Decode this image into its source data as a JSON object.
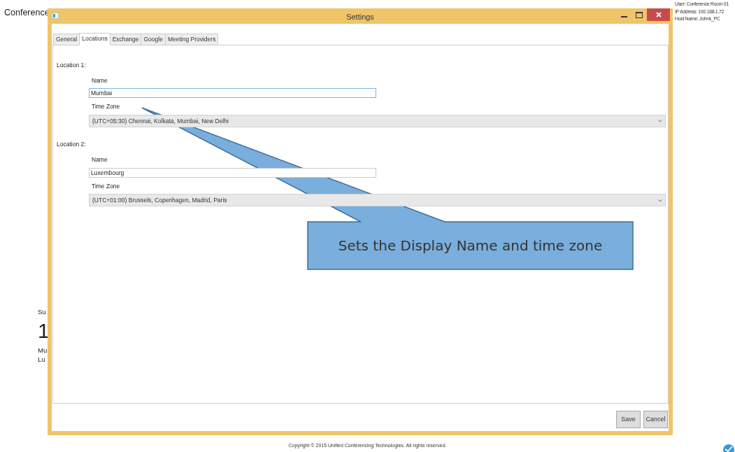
{
  "background": {
    "heading": "Conference",
    "summary_label": "Su",
    "big_number": "1",
    "line_1": "Mu",
    "line_2": "Lu",
    "user_info": [
      "User: Conference Room 01",
      "IP Address: 192.168.1.72",
      "Host Name: Johns_PC"
    ],
    "footer": "Copyright © 2015 Unified Conferencing Technologies. All rights reserved."
  },
  "window": {
    "title": "Settings"
  },
  "tabs": [
    {
      "label": "General",
      "selected": false
    },
    {
      "label": "Locations",
      "selected": true
    },
    {
      "label": "Exchange",
      "selected": false
    },
    {
      "label": "Google",
      "selected": false
    },
    {
      "label": "Meeting Providers",
      "selected": false
    }
  ],
  "locations": [
    {
      "heading": "Location 1:",
      "name_label": "Name",
      "name_value": "Mumbai",
      "focused": true,
      "timezone_label": "Time Zone",
      "timezone_value": "(UTC+05:30) Chennai, Kolkata, Mumbai, New Delhi"
    },
    {
      "heading": "Location 2:",
      "name_label": "Name",
      "name_value": "Luxembourg",
      "focused": false,
      "timezone_label": "Time Zone",
      "timezone_value": "(UTC+01:00) Brussels, Copenhagen, Madrid, Paris"
    }
  ],
  "buttons": [
    "Save",
    "Cancel"
  ],
  "callout": {
    "text": "Sets the Display Name and time zone"
  }
}
